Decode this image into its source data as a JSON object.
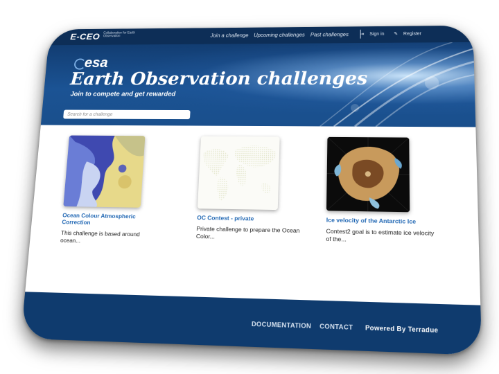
{
  "topbar": {
    "brand": "E-CEO",
    "brand_tagline": "Collaborative for Earth Observation",
    "nav": [
      "Join a challenge",
      "Upcoming challenges",
      "Past challenges"
    ],
    "signin": "Sign in",
    "register": "Register"
  },
  "hero": {
    "logo_text": "esa",
    "title": "Earth Observation challenges",
    "subtitle": "Join to compete and get rewarded",
    "search_placeholder": "Search for a challenge"
  },
  "challenges": [
    {
      "title": "Ocean Colour Atmospheric Correction",
      "description": "This challenge is based around ocean..."
    },
    {
      "title": "OC Contest - private",
      "description": "Private challenge to prepare the Ocean Color..."
    },
    {
      "title": "Ice velocity of the Antarctic Ice",
      "description": "Contest2 goal is to estimate ice velocity of the..."
    }
  ],
  "footer": {
    "documentation": "DOCUMENTATION",
    "contact": "CONTACT",
    "powered_by": "Powered By Terradue"
  },
  "colors": {
    "topbar": "#0d2e57",
    "hero": "#1b5394",
    "link": "#1f66b3",
    "footer": "#0f3b6e"
  }
}
